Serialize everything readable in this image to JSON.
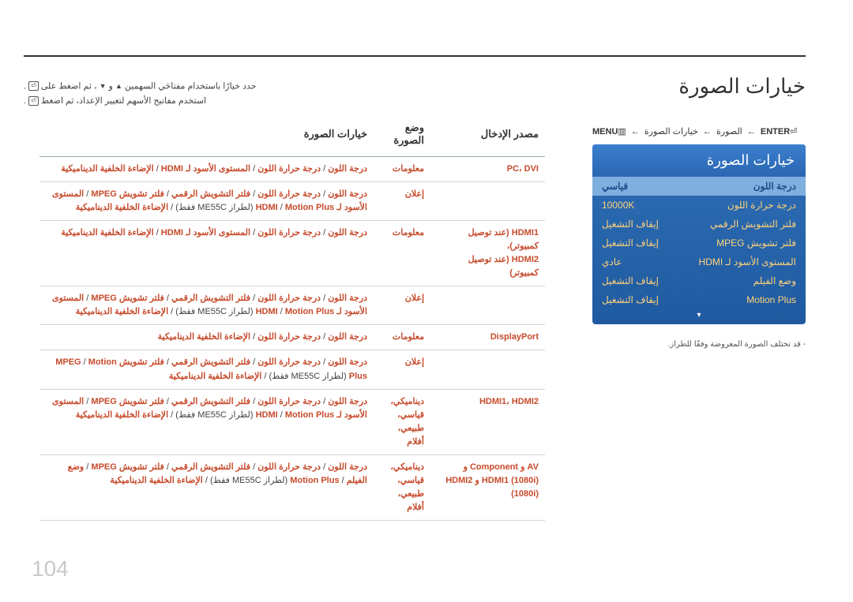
{
  "page_title": "خيارات الصورة",
  "breadcrumb": {
    "menu": "MENU",
    "menu_icon": "▥",
    "arrow": "←",
    "image": "الصورة",
    "options": "خيارات الصورة",
    "enter": "ENTER",
    "enter_icon": "⏎"
  },
  "nav_instructions": {
    "line1_pre": "حدد خيارًا باستخدام مفتاحَي السهمين ",
    "and": " و ",
    "line1_post": "، ثم اضغط على ",
    "line2_pre": "استخدم مفاتيح الأسهم لتغيير الإعداد، ثم اضغط ",
    "period": "."
  },
  "menu": {
    "title": "خيارات الصورة",
    "rows": [
      {
        "label": "درجة اللون",
        "value": "قياسي"
      },
      {
        "label": "درجة حرارة اللون",
        "value": "10000K"
      },
      {
        "label": "فلتر التشويش الرقمي",
        "value": "إيقاف التشغيل"
      },
      {
        "label": "فلتر تشويش MPEG",
        "value": "إيقاف التشغيل"
      },
      {
        "label": "المستوى الأسود لـ HDMI",
        "value": "عادي"
      },
      {
        "label": "وضع الفيلم",
        "value": "إيقاف التشغيل"
      },
      {
        "label": "Motion Plus",
        "value": "إيقاف التشغيل"
      }
    ]
  },
  "footnote": "- قد تختلف الصورة المعروضة وفقًا للطراز.",
  "table": {
    "h1": "مصدر الإدخال",
    "h2": "وضع الصورة",
    "h3": "خيارات الصورة",
    "rows": [
      {
        "src": "PC، DVI",
        "mode": "معلومات",
        "opts": "<span class='hl'>درجة اللون</span> / <span class='hl'>درجة حرارة اللون</span> / <span class='hl'>المستوى الأسود لـ HDMI</span> / <span class='hl'>الإضاءة الخلفية الديناميكية</span>"
      },
      {
        "src": "",
        "mode": "إعلان",
        "opts": "<span class='hl'>درجة اللون</span> / <span class='hl'>درجة حرارة اللون</span> / <span class='hl'>فلتر التشويش الرقمي</span> / <span class='hl'>فلتر تشويش MPEG</span> / <span class='hl'>المستوى الأسود لـ HDMI</span> / <span class='hl'>Motion Plus</span> (لطراز ME55C فقط) / <span class='hl'>الإضاءة الخلفية الديناميكية</span>"
      },
      {
        "src": "HDMI1 (عند توصيل كمبيوتر)،<br>HDMI2 (عند توصيل كمبيوتر)",
        "mode": "معلومات",
        "opts": "<span class='hl'>درجة اللون</span> / <span class='hl'>درجة حرارة اللون</span> / <span class='hl'>المستوى الأسود لـ HDMI</span> / <span class='hl'>الإضاءة الخلفية الديناميكية</span>"
      },
      {
        "src": "",
        "mode": "إعلان",
        "opts": "<span class='hl'>درجة اللون</span> / <span class='hl'>درجة حرارة اللون</span> / <span class='hl'>فلتر التشويش الرقمي</span> / <span class='hl'>فلتر تشويش MPEG</span> / <span class='hl'>المستوى الأسود لـ HDMI</span> / <span class='hl'>Motion Plus</span> (لطراز ME55C فقط) / <span class='hl'>الإضاءة الخلفية الديناميكية</span>"
      },
      {
        "src": "DisplayPort",
        "mode": "معلومات",
        "opts": "<span class='hl'>درجة اللون</span> / <span class='hl'>درجة حرارة اللون</span> / <span class='hl'>الإضاءة الخلفية الديناميكية</span>"
      },
      {
        "src": "",
        "mode": "إعلان",
        "opts": "<span class='hl'>درجة اللون</span> / <span class='hl'>درجة حرارة اللون</span> / <span class='hl'>فلتر التشويش الرقمي</span> / <span class='hl'>فلتر تشويش MPEG</span> / <span class='hl'>Motion Plus</span> (لطراز ME55C فقط) / <span class='hl'>الإضاءة الخلفية الديناميكية</span>"
      },
      {
        "src": "HDMI1، HDMI2",
        "mode": "ديناميكي، قياسي، طبيعي، أفلام",
        "opts": "<span class='hl'>درجة اللون</span> / <span class='hl'>درجة حرارة اللون</span> / <span class='hl'>فلتر التشويش الرقمي</span> / <span class='hl'>فلتر تشويش MPEG</span> / <span class='hl'>المستوى الأسود لـ HDMI</span> / <span class='hl'>Motion Plus</span> (لطراز ME55C فقط) / <span class='hl'>الإضاءة الخلفية الديناميكية</span>"
      },
      {
        "src": "AV و Component و HDMI1 (1080i) و HDMI2 (1080i)",
        "mode": "ديناميكي، قياسي، طبيعي، أفلام",
        "opts": "<span class='hl'>درجة اللون</span> / <span class='hl'>درجة حرارة اللون</span> / <span class='hl'>فلتر التشويش الرقمي</span> / <span class='hl'>فلتر تشويش MPEG</span> / <span class='hl'>وضع الفيلم</span> / <span class='hl'>Motion Plus</span> (لطراز ME55C فقط) / <span class='hl'>الإضاءة الخلفية الديناميكية</span>"
      }
    ]
  },
  "page_number": "104"
}
